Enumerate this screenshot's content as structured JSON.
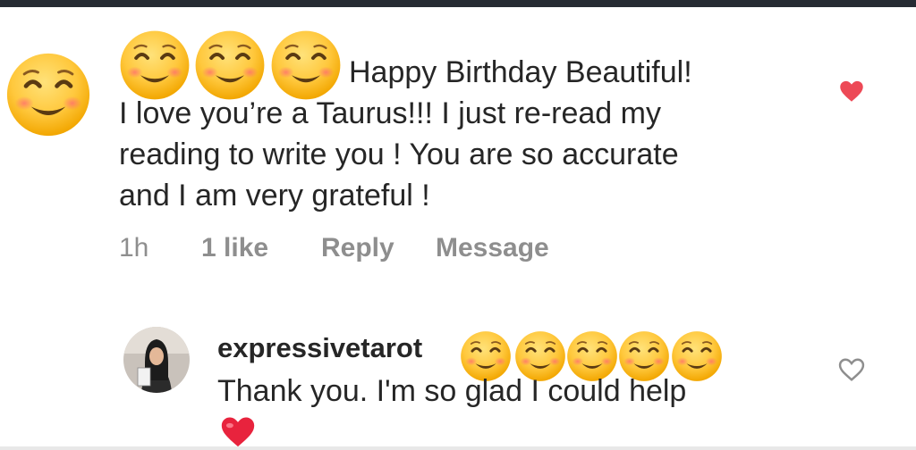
{
  "comment": {
    "text_line1": "Happy Birthday Beautiful!",
    "text_line2": "I love you’re a Taurus!!! I just re-read my",
    "text_line3": "reading to write you ! You are so accurate",
    "text_line4": "and I am very grateful !",
    "time": "1h",
    "likes": "1 like",
    "reply_label": "Reply",
    "message_label": "Message",
    "liked": true
  },
  "reply": {
    "username": "expressivetarot",
    "text": "Thank you. I'm so glad I could help",
    "liked": false
  },
  "colors": {
    "heart_red": "#ed4956",
    "text": "#262626",
    "meta_gray": "#8e8e8e",
    "emoji_yellow": "#ffc83d"
  },
  "icons": {
    "emoji": "smiling-face-with-smiling-eyes",
    "like_filled": "heart-filled-icon",
    "like_outline": "heart-outline-icon",
    "reply_emoji": "red-heart-emoji"
  }
}
